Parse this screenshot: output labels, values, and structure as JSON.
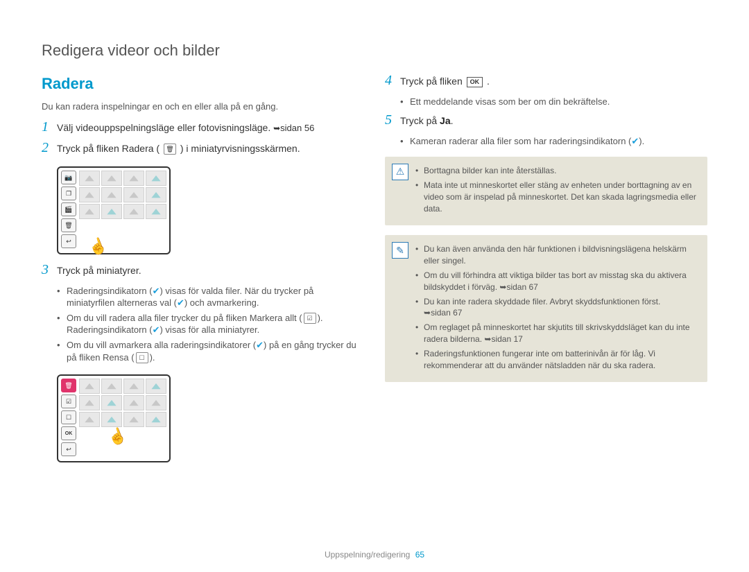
{
  "page_title": "Redigera videor och bilder",
  "section_heading": "Radera",
  "intro_text": "Du kan radera inspelningar en och en eller alla på en gång.",
  "steps": {
    "s1": {
      "num": "1",
      "text_a": "Välj videouppspelningsläge eller fotovisningsläge. ",
      "page_ref": "sidan 56"
    },
    "s2": {
      "num": "2",
      "text_a": "Tryck på fliken Radera (",
      "text_b": ") i miniatyrvisningsskärmen."
    },
    "s3": {
      "num": "3",
      "text_a": "Tryck på miniatyrer."
    },
    "s4": {
      "num": "4",
      "text_a": "Tryck på fliken ",
      "ok": "OK",
      "text_b": "."
    },
    "s5": {
      "num": "5",
      "text_a": "Tryck på ",
      "bold": "Ja",
      "text_b": "."
    }
  },
  "step3_bullets": [
    {
      "pre": "Raderingsindikatorn (",
      "post": ") visas för valda filer. När du trycker på miniatyrfilen alterneras val (",
      "post2": ") och avmarkering."
    },
    {
      "pre": "Om du vill radera alla filer trycker du på fliken Markera allt (",
      "post": "). Raderingsindikatorn (",
      "post2": ") visas för alla miniatyrer."
    },
    {
      "pre": "Om du vill avmarkera alla raderingsindikatorer (",
      "post": ") på en gång trycker du på fliken Rensa (",
      "post2": ")."
    }
  ],
  "step4_bullets": [
    "Ett meddelande visas som ber om din bekräftelse."
  ],
  "step5_bullets_pre": "Kameran raderar alla filer som har raderingsindikatorn (",
  "step5_bullets_post": ").",
  "warning_box": [
    "Borttagna bilder kan inte återställas.",
    "Mata inte ut minneskortet eller stäng av enheten under borttagning av en video som är inspelad på minneskortet. Det kan skada lagringsmedia eller data."
  ],
  "note_box": [
    {
      "text": "Du kan även använda den här funktionen i bildvisningslägena helskärm eller singel."
    },
    {
      "text": "Om du vill förhindra att viktiga bilder tas bort av misstag ska du aktivera bildskyddet i förväg. ",
      "ref": "sidan 67"
    },
    {
      "text": "Du kan inte radera skyddade filer. Avbryt skyddsfunktionen först. ",
      "ref": "sidan 67"
    },
    {
      "text": "Om reglaget på minneskortet har skjutits till skrivskyddsläget kan du inte radera bilderna. ",
      "ref": "sidan 17"
    },
    {
      "text": "Raderingsfunktionen fungerar inte om batterinivån är för låg. Vi rekommenderar att du använder nätsladden när du ska radera."
    }
  ],
  "icons": {
    "trash": "🗑",
    "check": "✔",
    "select_all": "☑",
    "clear": "☐",
    "ok": "OK",
    "warning": "⚠",
    "note": "✎",
    "back": "↩",
    "camera": "📷",
    "film": "🎬",
    "overlay": "❐",
    "arrow": "➥"
  },
  "side_tabs_1": [
    "camera",
    "overlay",
    "film",
    "trash",
    "back"
  ],
  "side_tabs_2": [
    "trash",
    "select_all",
    "clear",
    "ok",
    "back"
  ],
  "footer": {
    "section": "Uppspelning/redigering",
    "page": "65"
  }
}
